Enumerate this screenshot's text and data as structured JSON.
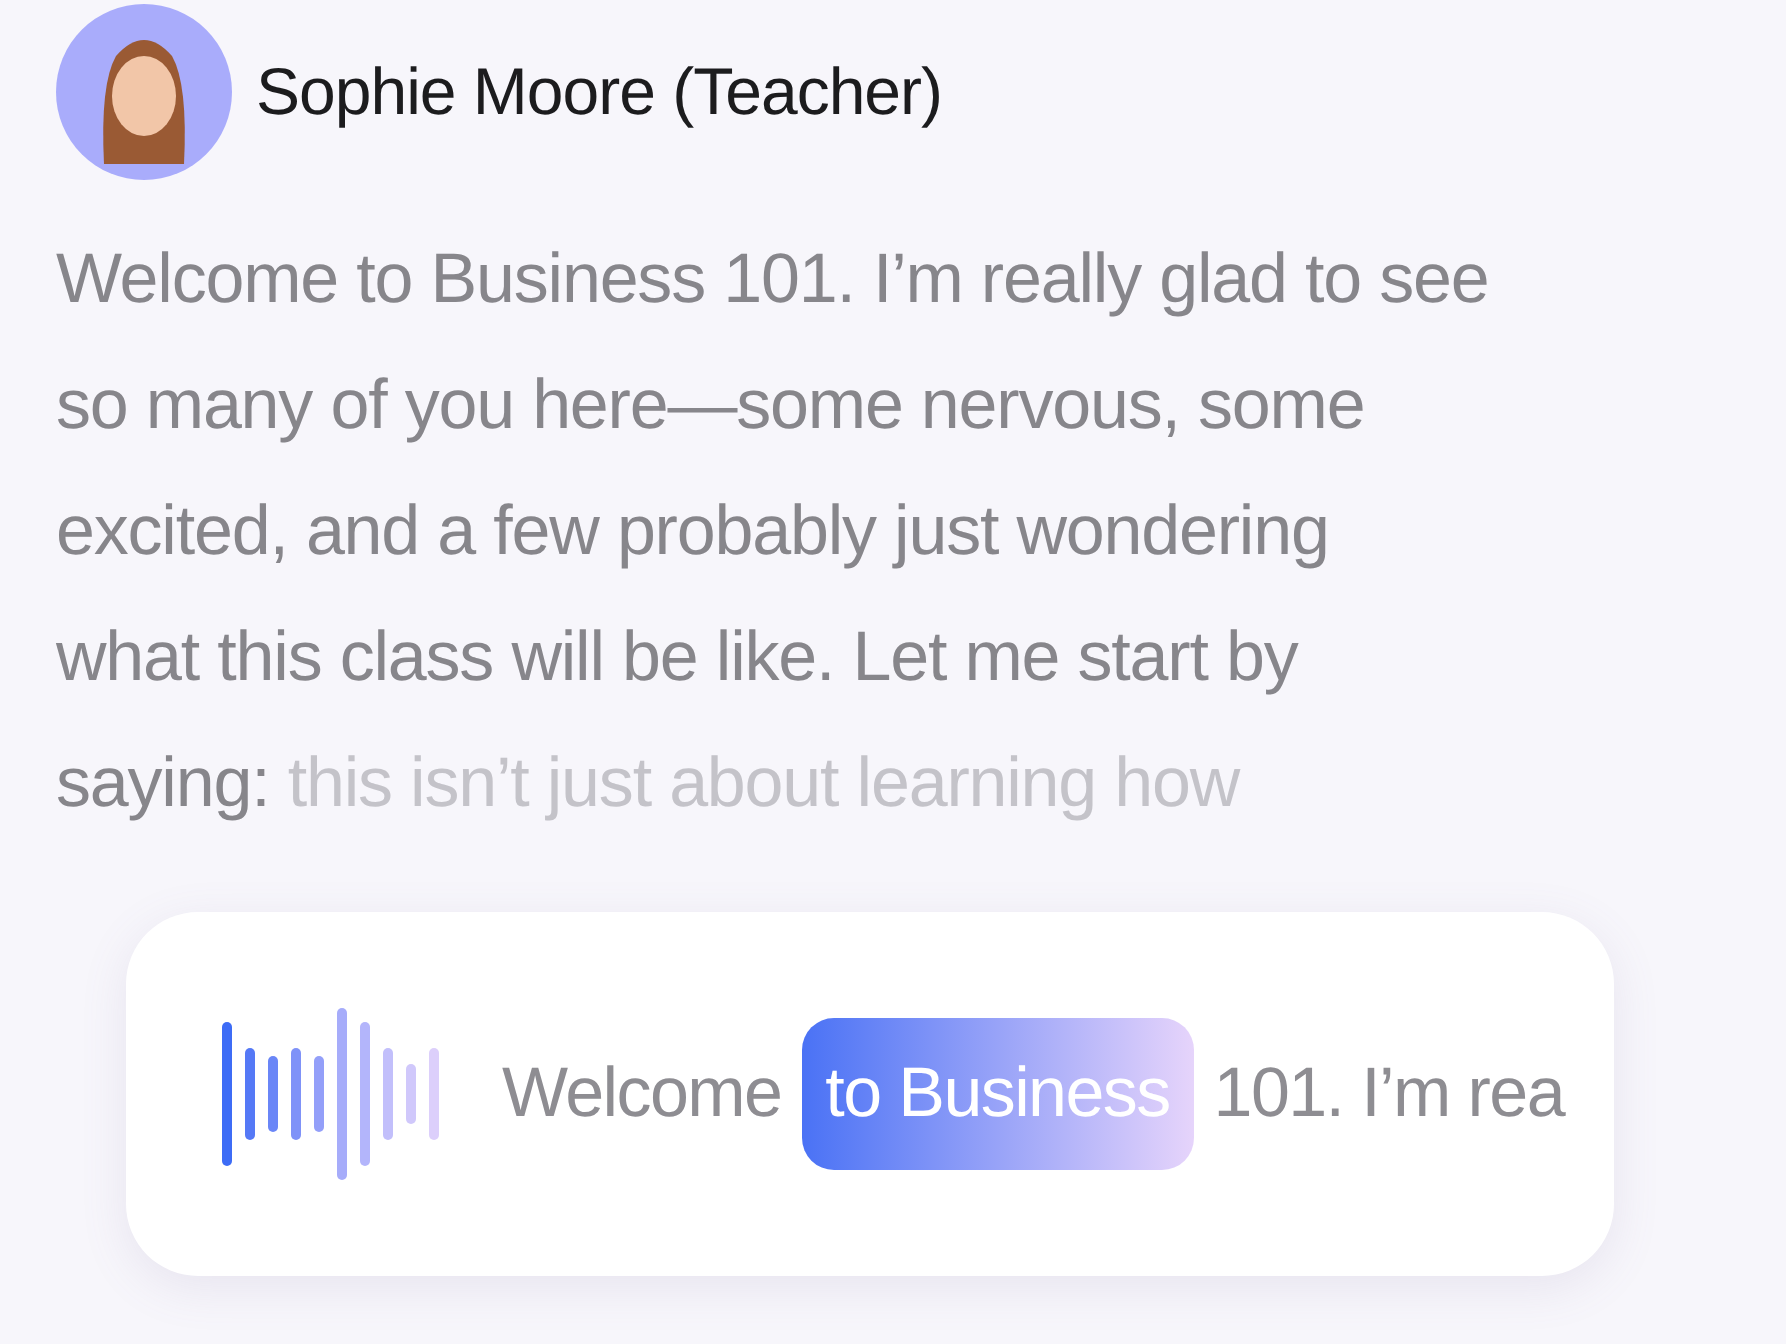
{
  "speaker": {
    "name": "Sophie Moore (Teacher)"
  },
  "transcript_lines": [
    [
      {
        "text": "Welcome to Business 101. I’m really glad to see",
        "spoken": true
      }
    ],
    [
      {
        "text": "so many of you here—some nervous, some",
        "spoken": true
      }
    ],
    [
      {
        "text": "excited, and a few probably just wondering",
        "spoken": true
      }
    ],
    [
      {
        "text": "what this class will be like. Let me start by",
        "spoken": true
      }
    ],
    [
      {
        "text": "saying:",
        "spoken": true
      },
      {
        "text": " this isn’t just about learning how",
        "spoken": false
      }
    ]
  ],
  "caption": {
    "words": [
      {
        "text": "Welcome",
        "highlighted": false
      },
      {
        "text": "to Business",
        "highlighted": true
      },
      {
        "text": "101. I’m rea",
        "highlighted": false
      }
    ]
  }
}
